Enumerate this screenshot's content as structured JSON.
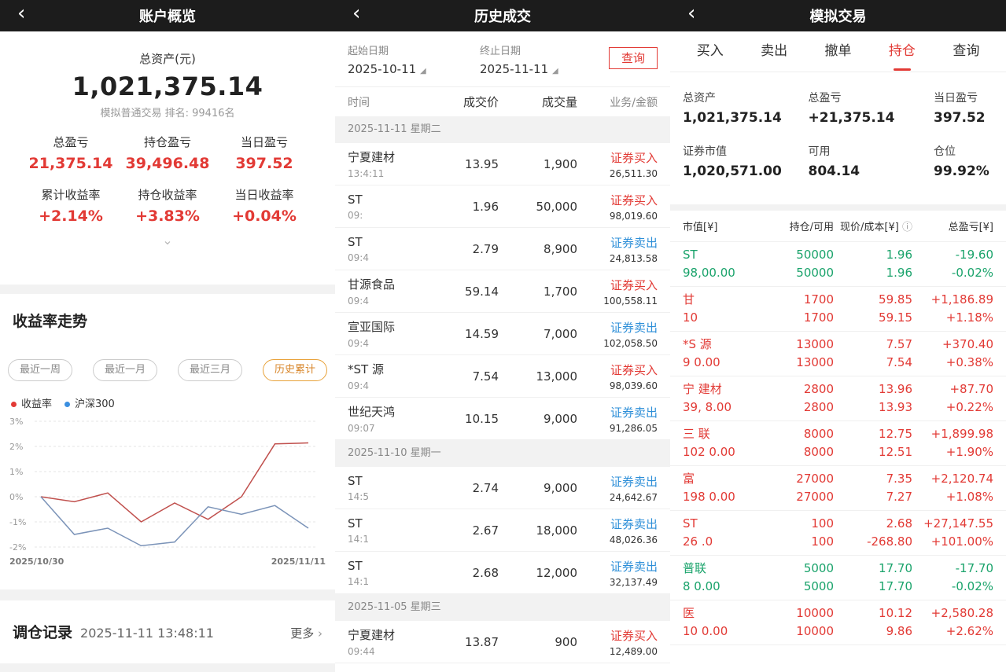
{
  "overview": {
    "header_title": "账户概览",
    "total_assets_label": "总资产(元)",
    "total_assets": "1,021,375.14",
    "sub_text": "模拟普通交易 排名: 99416名",
    "stats_row1": [
      {
        "label": "总盈亏",
        "value": "21,375.14"
      },
      {
        "label": "持仓盈亏",
        "value": "39,496.48"
      },
      {
        "label": "当日盈亏",
        "value": "397.52"
      }
    ],
    "stats_row2": [
      {
        "label": "累计收益率",
        "value": "+2.14%"
      },
      {
        "label": "持仓收益率",
        "value": "+3.83%"
      },
      {
        "label": "当日收益率",
        "value": "+0.04%"
      }
    ],
    "trend_title": "收益率走势",
    "ranges": [
      "最近一周",
      "最近一月",
      "最近三月",
      "历史累计"
    ],
    "legend": [
      "收益率",
      "沪深300"
    ],
    "record_title": "调仓记录",
    "record_time": "2025-11-11 13:48:11",
    "more_label": "更多"
  },
  "chart_data": {
    "type": "line",
    "x": [
      "2025/10/30",
      "",
      "",
      "",
      "",
      "",
      "",
      "",
      "",
      "2025/11/11"
    ],
    "x_tick_labels": [
      "2025/10/30",
      "2025/11/11"
    ],
    "y_ticks": [
      "3%",
      "2%",
      "1%",
      "0%",
      "-1%",
      "-2%"
    ],
    "ylim": [
      -2,
      3
    ],
    "series": [
      {
        "name": "收益率",
        "color": "#c0504d",
        "values": [
          0,
          -0.2,
          0.15,
          -1.0,
          -0.25,
          -0.9,
          0.0,
          2.1,
          2.14
        ]
      },
      {
        "name": "沪深300",
        "color": "#7b93b8",
        "values": [
          0,
          -1.5,
          -1.25,
          -1.95,
          -1.8,
          -0.4,
          -0.7,
          -0.35,
          -1.25
        ]
      }
    ]
  },
  "history": {
    "header_title": "历史成交",
    "start_label": "起始日期",
    "start_value": "2025-10-11",
    "end_label": "终止日期",
    "end_value": "2025-11-11",
    "query_label": "查询",
    "columns": [
      "时间",
      "成交价",
      "成交量",
      "业务/金额"
    ],
    "groups": [
      {
        "date": "2025-11-11 星期二",
        "rows": [
          {
            "name": "宁夏建材",
            "time": "13:4:11",
            "price": "13.95",
            "qty": "1,900",
            "biz": "证券买入",
            "amount": "26,511.30",
            "dir": "buy"
          },
          {
            "name": "ST",
            "time": "09:",
            "price": "1.96",
            "qty": "50,000",
            "biz": "证券买入",
            "amount": "98,019.60",
            "dir": "buy"
          },
          {
            "name": "ST",
            "time": "09:4",
            "price": "2.79",
            "qty": "8,900",
            "biz": "证券卖出",
            "amount": "24,813.58",
            "dir": "sell"
          },
          {
            "name": "甘源食品",
            "time": "09:4",
            "price": "59.14",
            "qty": "1,700",
            "biz": "证券买入",
            "amount": "100,558.11",
            "dir": "buy"
          },
          {
            "name": "宣亚国际",
            "time": "09:4",
            "price": "14.59",
            "qty": "7,000",
            "biz": "证券卖出",
            "amount": "102,058.50",
            "dir": "sell"
          },
          {
            "name": "*ST 源",
            "time": "09:4",
            "price": "7.54",
            "qty": "13,000",
            "biz": "证券买入",
            "amount": "98,039.60",
            "dir": "buy"
          },
          {
            "name": "世纪天鸿",
            "time": "09:07",
            "price": "10.15",
            "qty": "9,000",
            "biz": "证券卖出",
            "amount": "91,286.05",
            "dir": "sell"
          }
        ]
      },
      {
        "date": "2025-11-10 星期一",
        "rows": [
          {
            "name": "ST",
            "time": "14:5",
            "price": "2.74",
            "qty": "9,000",
            "biz": "证券卖出",
            "amount": "24,642.67",
            "dir": "sell"
          },
          {
            "name": "ST",
            "time": "14:1",
            "price": "2.67",
            "qty": "18,000",
            "biz": "证券卖出",
            "amount": "48,026.36",
            "dir": "sell"
          },
          {
            "name": "ST",
            "time": "14:1",
            "price": "2.68",
            "qty": "12,000",
            "biz": "证券卖出",
            "amount": "32,137.49",
            "dir": "sell"
          }
        ]
      },
      {
        "date": "2025-11-05 星期三",
        "rows": [
          {
            "name": "宁夏建材",
            "time": "09:44",
            "price": "13.87",
            "qty": "900",
            "biz": "证券买入",
            "amount": "12,489.00",
            "dir": "buy"
          }
        ]
      }
    ]
  },
  "sim": {
    "header_title": "模拟交易",
    "tabs": [
      "买入",
      "卖出",
      "撤单",
      "持仓",
      "查询"
    ],
    "active_tab": 3,
    "account": [
      {
        "label": "总资产",
        "value": "1,021,375.14",
        "tone": "dark"
      },
      {
        "label": "总盈亏",
        "value": "+21,375.14",
        "tone": "red"
      },
      {
        "label": "当日盈亏",
        "value": "397.52",
        "tone": "red"
      },
      {
        "label": "证券市值",
        "value": "1,020,571.00",
        "tone": "dark"
      },
      {
        "label": "可用",
        "value": "804.14",
        "tone": "dark"
      },
      {
        "label": "仓位",
        "value": "99.92%",
        "tone": "dark"
      }
    ],
    "columns": [
      "市值[¥]",
      "持仓/可用",
      "现价/成本[¥]",
      "总盈亏[¥]"
    ],
    "positions": [
      {
        "name": "ST",
        "mv": "98,00.00",
        "hold": "50000",
        "avail": "50000",
        "price": "1.96",
        "cost": "1.96",
        "pnl": "-19.60",
        "pct": "-0.02%",
        "tone": "green"
      },
      {
        "name": "甘",
        "mv": "10",
        "hold": "1700",
        "avail": "1700",
        "price": "59.85",
        "cost": "59.15",
        "pnl": "+1,186.89",
        "pct": "+1.18%",
        "tone": "red"
      },
      {
        "name": "*S 源",
        "mv": "9 0.00",
        "hold": "13000",
        "avail": "13000",
        "price": "7.57",
        "cost": "7.54",
        "pnl": "+370.40",
        "pct": "+0.38%",
        "tone": "red"
      },
      {
        "name": "宁 建材",
        "mv": "39, 8.00",
        "hold": "2800",
        "avail": "2800",
        "price": "13.96",
        "cost": "13.93",
        "pnl": "+87.70",
        "pct": "+0.22%",
        "tone": "red"
      },
      {
        "name": "三 联",
        "mv": "102 0.00",
        "hold": "8000",
        "avail": "8000",
        "price": "12.75",
        "cost": "12.51",
        "pnl": "+1,899.98",
        "pct": "+1.90%",
        "tone": "red"
      },
      {
        "name": "富",
        "mv": "198 0.00",
        "hold": "27000",
        "avail": "27000",
        "price": "7.35",
        "cost": "7.27",
        "pnl": "+2,120.74",
        "pct": "+1.08%",
        "tone": "red"
      },
      {
        "name": "ST",
        "mv": "26 .0",
        "hold": "100",
        "avail": "100",
        "price": "2.68",
        "cost": "-268.80",
        "pnl": "+27,147.55",
        "pct": "+101.00%",
        "tone": "red"
      },
      {
        "name": "普联",
        "mv": "8 0.00",
        "hold": "5000",
        "avail": "5000",
        "price": "17.70",
        "cost": "17.70",
        "pnl": "-17.70",
        "pct": "-0.02%",
        "tone": "green"
      },
      {
        "name": "医",
        "mv": "10 0.00",
        "hold": "10000",
        "avail": "10000",
        "price": "10.12",
        "cost": "9.86",
        "pnl": "+2,580.28",
        "pct": "+2.62%",
        "tone": "red"
      }
    ]
  }
}
